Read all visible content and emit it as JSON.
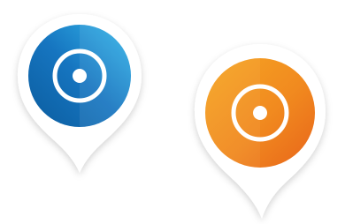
{
  "pins": [
    {
      "name": "blue-map-pin",
      "color_light": "#33b6ea",
      "color_dark": "#0b5c9e",
      "glyph_color": "#ffffff",
      "icon": "target-ring-icon"
    },
    {
      "name": "orange-map-pin",
      "color_light": "#f6a623",
      "color_dark": "#e8651a",
      "glyph_color": "#ffffff",
      "icon": "target-ring-icon"
    }
  ]
}
